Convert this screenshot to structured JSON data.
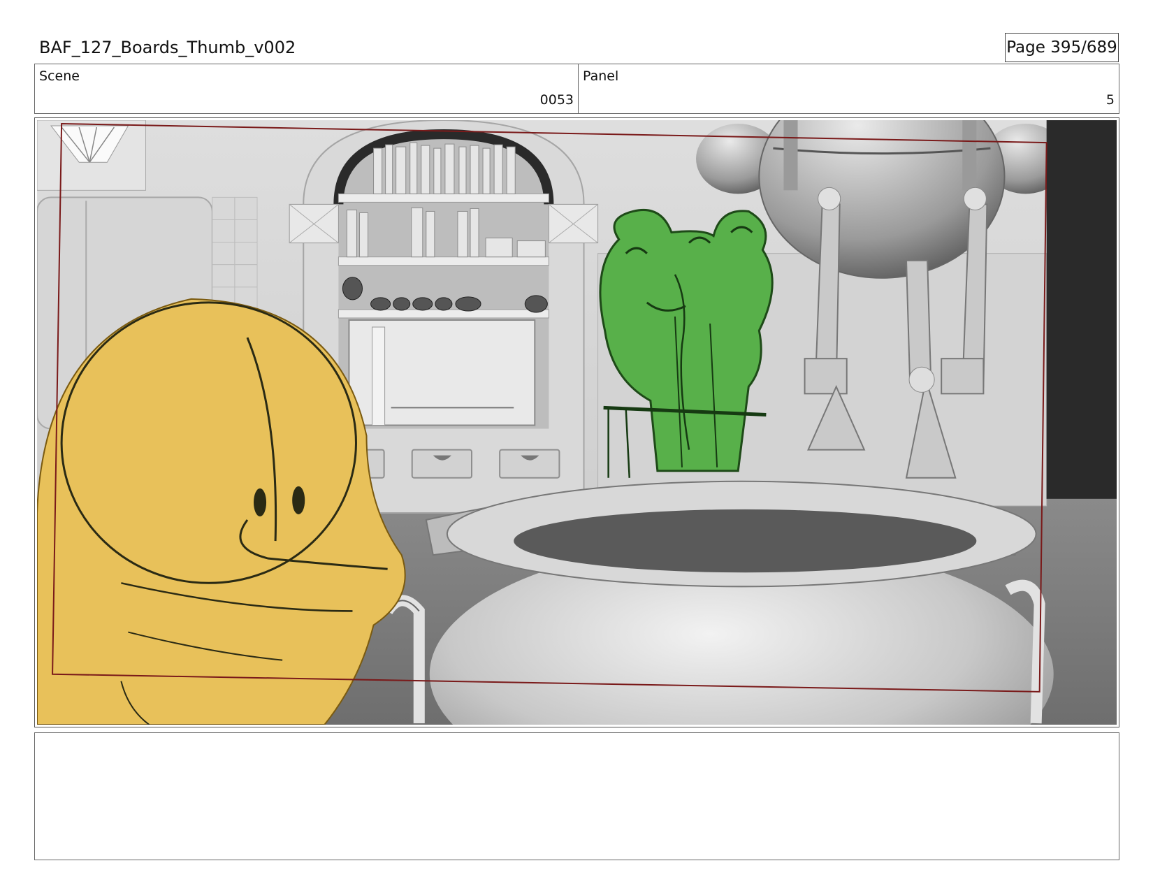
{
  "document": {
    "title": "BAF_127_Boards_Thumb_v002",
    "page_label": "Page 395/689"
  },
  "info": {
    "scene_label": "Scene",
    "scene_value": "0053",
    "panel_label": "Panel",
    "panel_value": "5"
  },
  "notes": {
    "text": ""
  },
  "colors": {
    "safe_frame": "#7a1a1a",
    "frog_green": "#58b04a",
    "blob_yellow": "#e8c15a"
  }
}
